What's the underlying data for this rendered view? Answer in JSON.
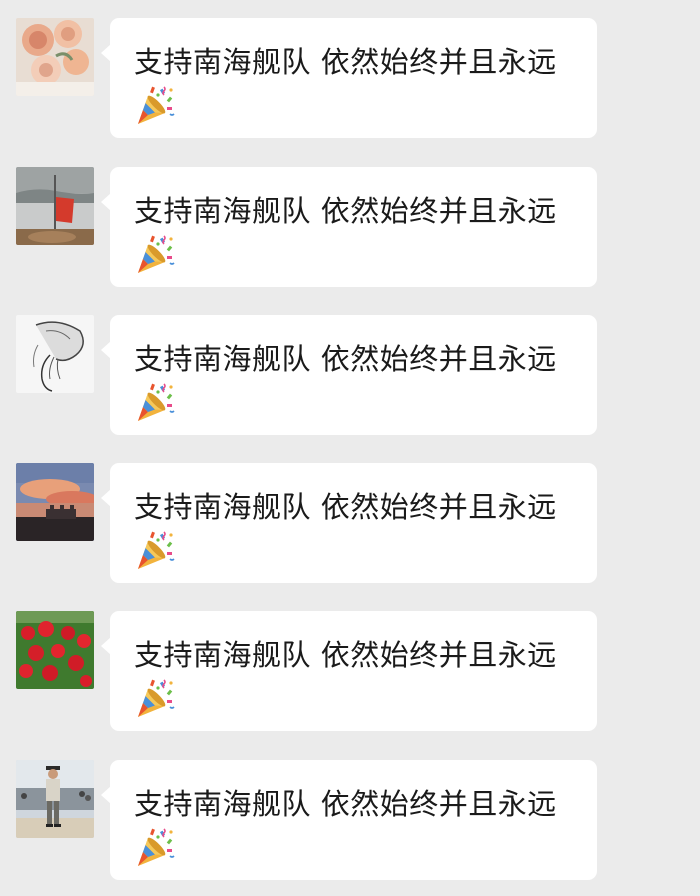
{
  "messages": [
    {
      "text": "支持南海舰队 依然始终并且永远",
      "emoji": "party-popper-icon",
      "avatar": "avatar-peach-roses"
    },
    {
      "text": "支持南海舰队 依然始终并且永远",
      "emoji": "party-popper-icon",
      "avatar": "avatar-red-flag-boat"
    },
    {
      "text": "支持南海舰队 依然始终并且永远",
      "emoji": "party-popper-icon",
      "avatar": "avatar-sketch-girl"
    },
    {
      "text": "支持南海舰队 依然始终并且永远",
      "emoji": "party-popper-icon",
      "avatar": "avatar-sunset-skyline"
    },
    {
      "text": "支持南海舰队 依然始终并且永远",
      "emoji": "party-popper-icon",
      "avatar": "avatar-red-flowers"
    },
    {
      "text": "支持南海舰队 依然始终并且永远",
      "emoji": "party-popper-icon",
      "avatar": "avatar-person-crowd"
    }
  ],
  "colors": {
    "background": "#ebebeb",
    "bubble": "#ffffff",
    "text": "#1a1a1a"
  }
}
